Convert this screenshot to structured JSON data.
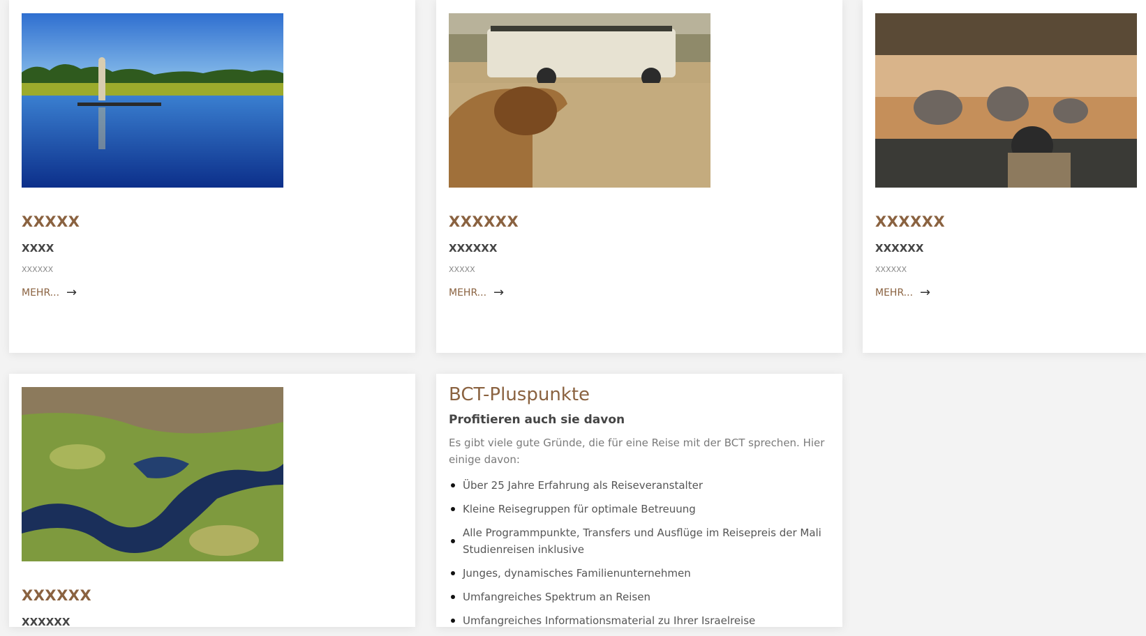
{
  "cards": [
    {
      "title": "XXXXX",
      "subtitle": "XXXX",
      "meta": "XXXXXX",
      "more": "MEHR...",
      "image": "mokoro-canoe-photo"
    },
    {
      "title": "XXXXXX",
      "subtitle": "XXXXXX",
      "meta": "XXXXX",
      "more": "MEHR...",
      "image": "lion-safari-photo"
    },
    {
      "title": "XXXXXX",
      "subtitle": "XXXXXX",
      "meta": "XXXXXX",
      "more": "MEHR...",
      "image": "elephant-game-drive-photo"
    },
    {
      "title": "XXXXXX",
      "subtitle": "XXXXXX",
      "image": "delta-aerial-photo"
    }
  ],
  "pluspunkte": {
    "title": "BCT-Pluspunkte",
    "subtitle": "Profitieren auch sie davon",
    "intro": "Es gibt viele gute Gründe, die für eine Reise mit der BCT sprechen. Hier einige davon:",
    "items": [
      "Über 25 Jahre Erfahrung als Reiseveranstalter",
      "Kleine Reisegruppen für optimale Betreuung",
      "Alle Programmpunkte, Transfers und Ausflüge im Reisepreis der Mali Studienreisen inklusive",
      "Junges, dynamisches Familienunternehmen",
      "Umfangreiches Spektrum an Reisen",
      "Umfangreiches Informationsmaterial zu Ihrer Israelreise"
    ]
  },
  "colors": {
    "accent": "#8a6240",
    "text": "#444444",
    "muted": "#7a7a7a"
  }
}
